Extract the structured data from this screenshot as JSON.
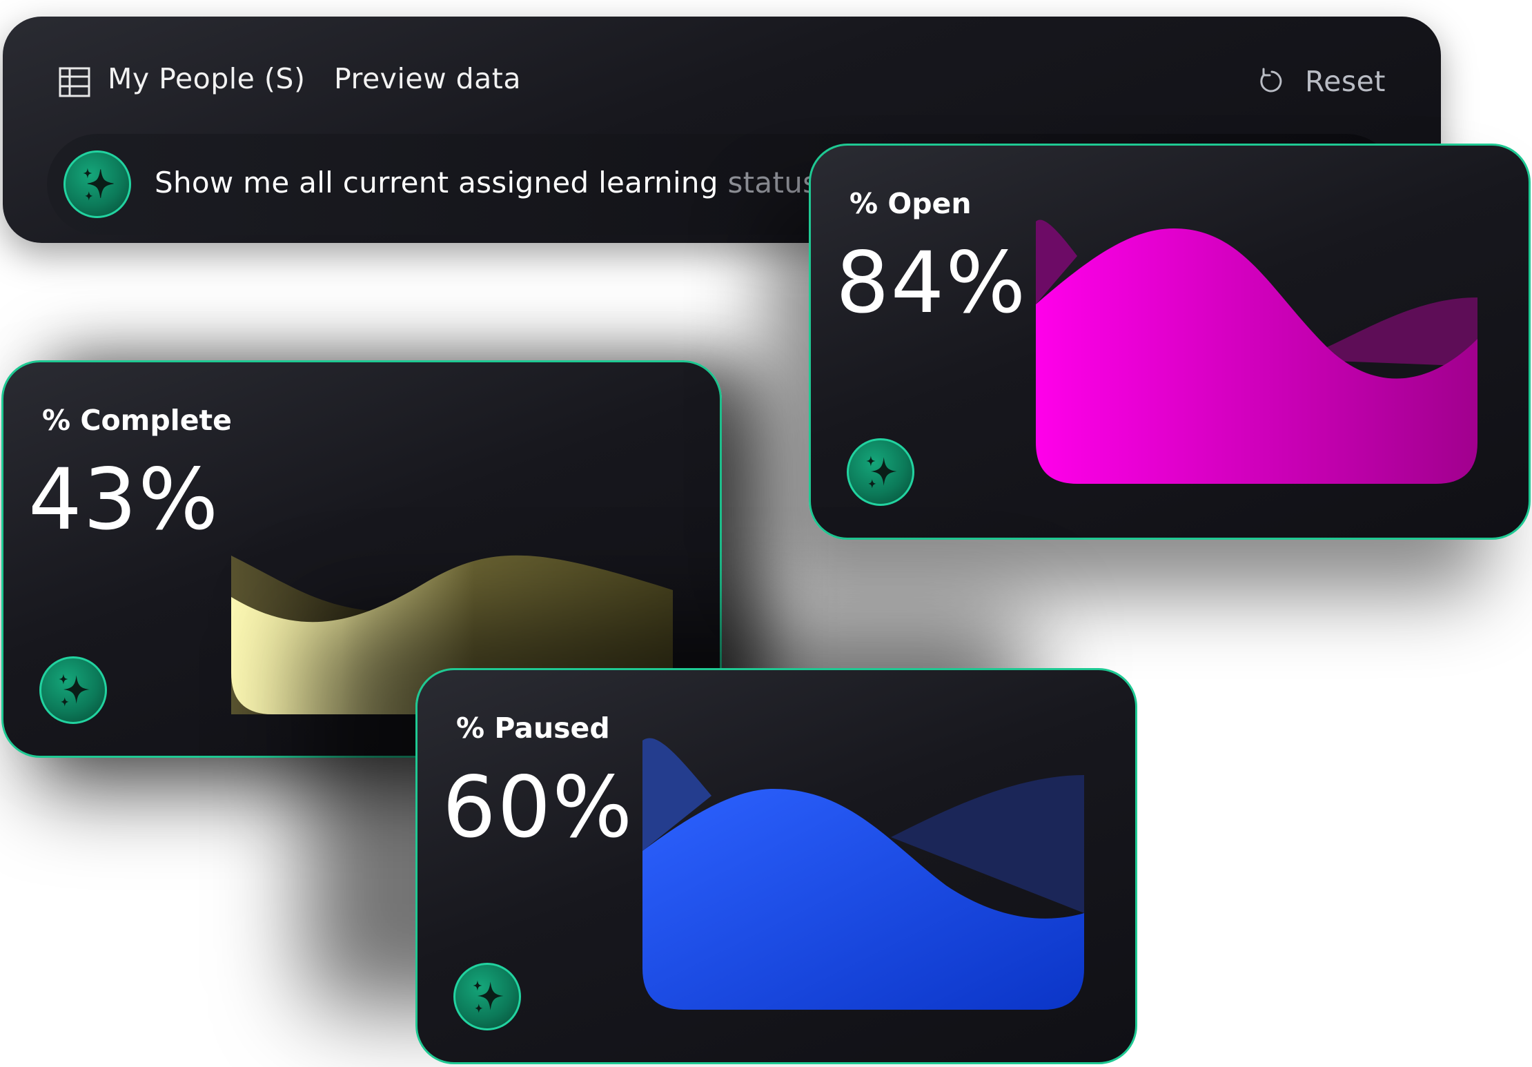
{
  "header": {
    "dataset_title": "My People (S)",
    "preview_link": "Preview data",
    "reset_label": "Reset",
    "table_icon": "table-grid-icon",
    "reset_icon": "reset-rotate-icon"
  },
  "query": {
    "text_main": "Show me all current assigned learning",
    "text_fade": " status’",
    "icon": "sparkle-ai-icon"
  },
  "cards": [
    {
      "label": "% Open",
      "value": "84%",
      "value_number": 84,
      "color": "#ff00e6"
    },
    {
      "label": "% Complete",
      "value": "43%",
      "value_number": 43,
      "color": "#f4ef9a"
    },
    {
      "label": "% Paused",
      "value": "60%",
      "value_number": 60,
      "color": "#2a5cf5"
    }
  ],
  "colors": {
    "accent_green": "#1fc993",
    "card_bg": "#17171d",
    "open_magenta": "#ff00e6",
    "complete_yellow": "#f4ef9a",
    "paused_blue": "#2a5cf5"
  }
}
